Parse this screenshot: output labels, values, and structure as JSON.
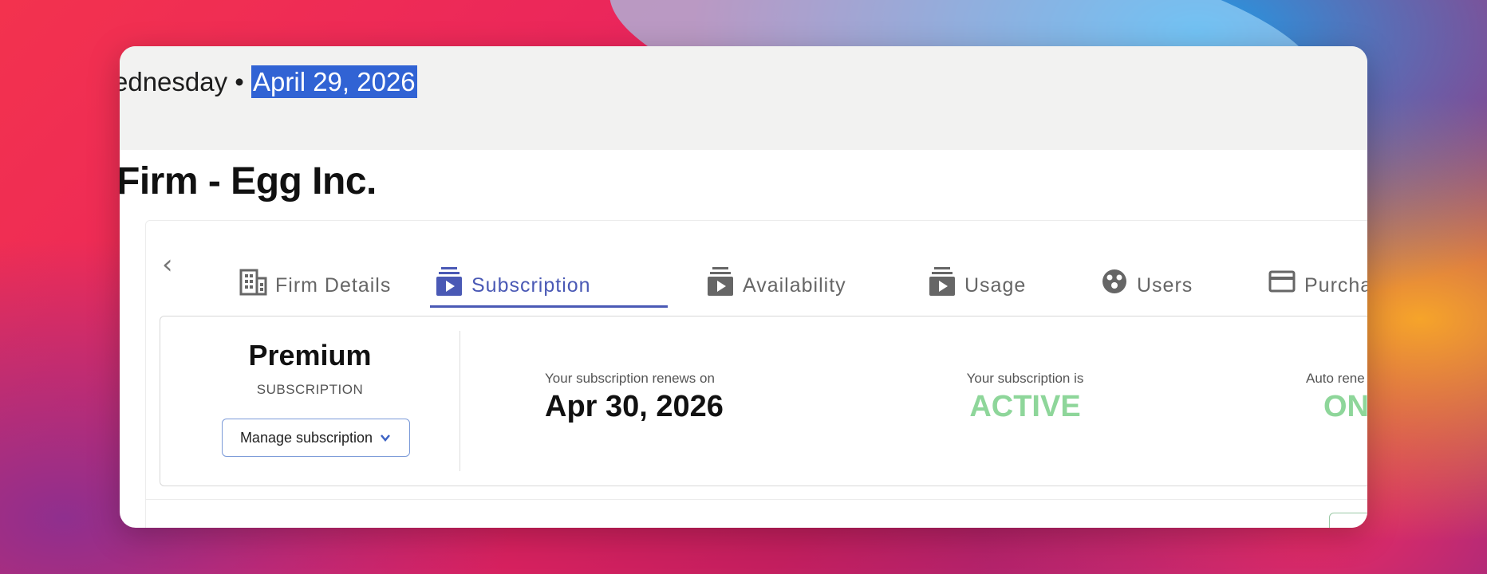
{
  "header": {
    "day": "ednesday",
    "separator": " • ",
    "date": "April 29, 2026"
  },
  "firm": {
    "title": "Firm - Egg Inc."
  },
  "tabs": [
    {
      "label": "Firm Details",
      "icon": "building-icon",
      "active": false
    },
    {
      "label": "Subscription",
      "icon": "subscription-icon",
      "active": true
    },
    {
      "label": "Availability",
      "icon": "availability-icon",
      "active": false
    },
    {
      "label": "Usage",
      "icon": "usage-icon",
      "active": false
    },
    {
      "label": "Users",
      "icon": "users-icon",
      "active": false
    },
    {
      "label": "Purcha",
      "icon": "card-icon",
      "active": false
    }
  ],
  "subscription": {
    "plan_name": "Premium",
    "plan_sub": "SUBSCRIPTION",
    "manage_label": "Manage subscription",
    "renews_label": "Your subscription renews on",
    "renews_value": "Apr 30, 2026",
    "status_label": "Your subscription is",
    "status_value": "ACTIVE",
    "auto_label": "Auto rene",
    "auto_value": "ON"
  },
  "colors": {
    "accent": "#4a59b5",
    "active_green": "#8ed69a",
    "selection": "#3163d4"
  }
}
